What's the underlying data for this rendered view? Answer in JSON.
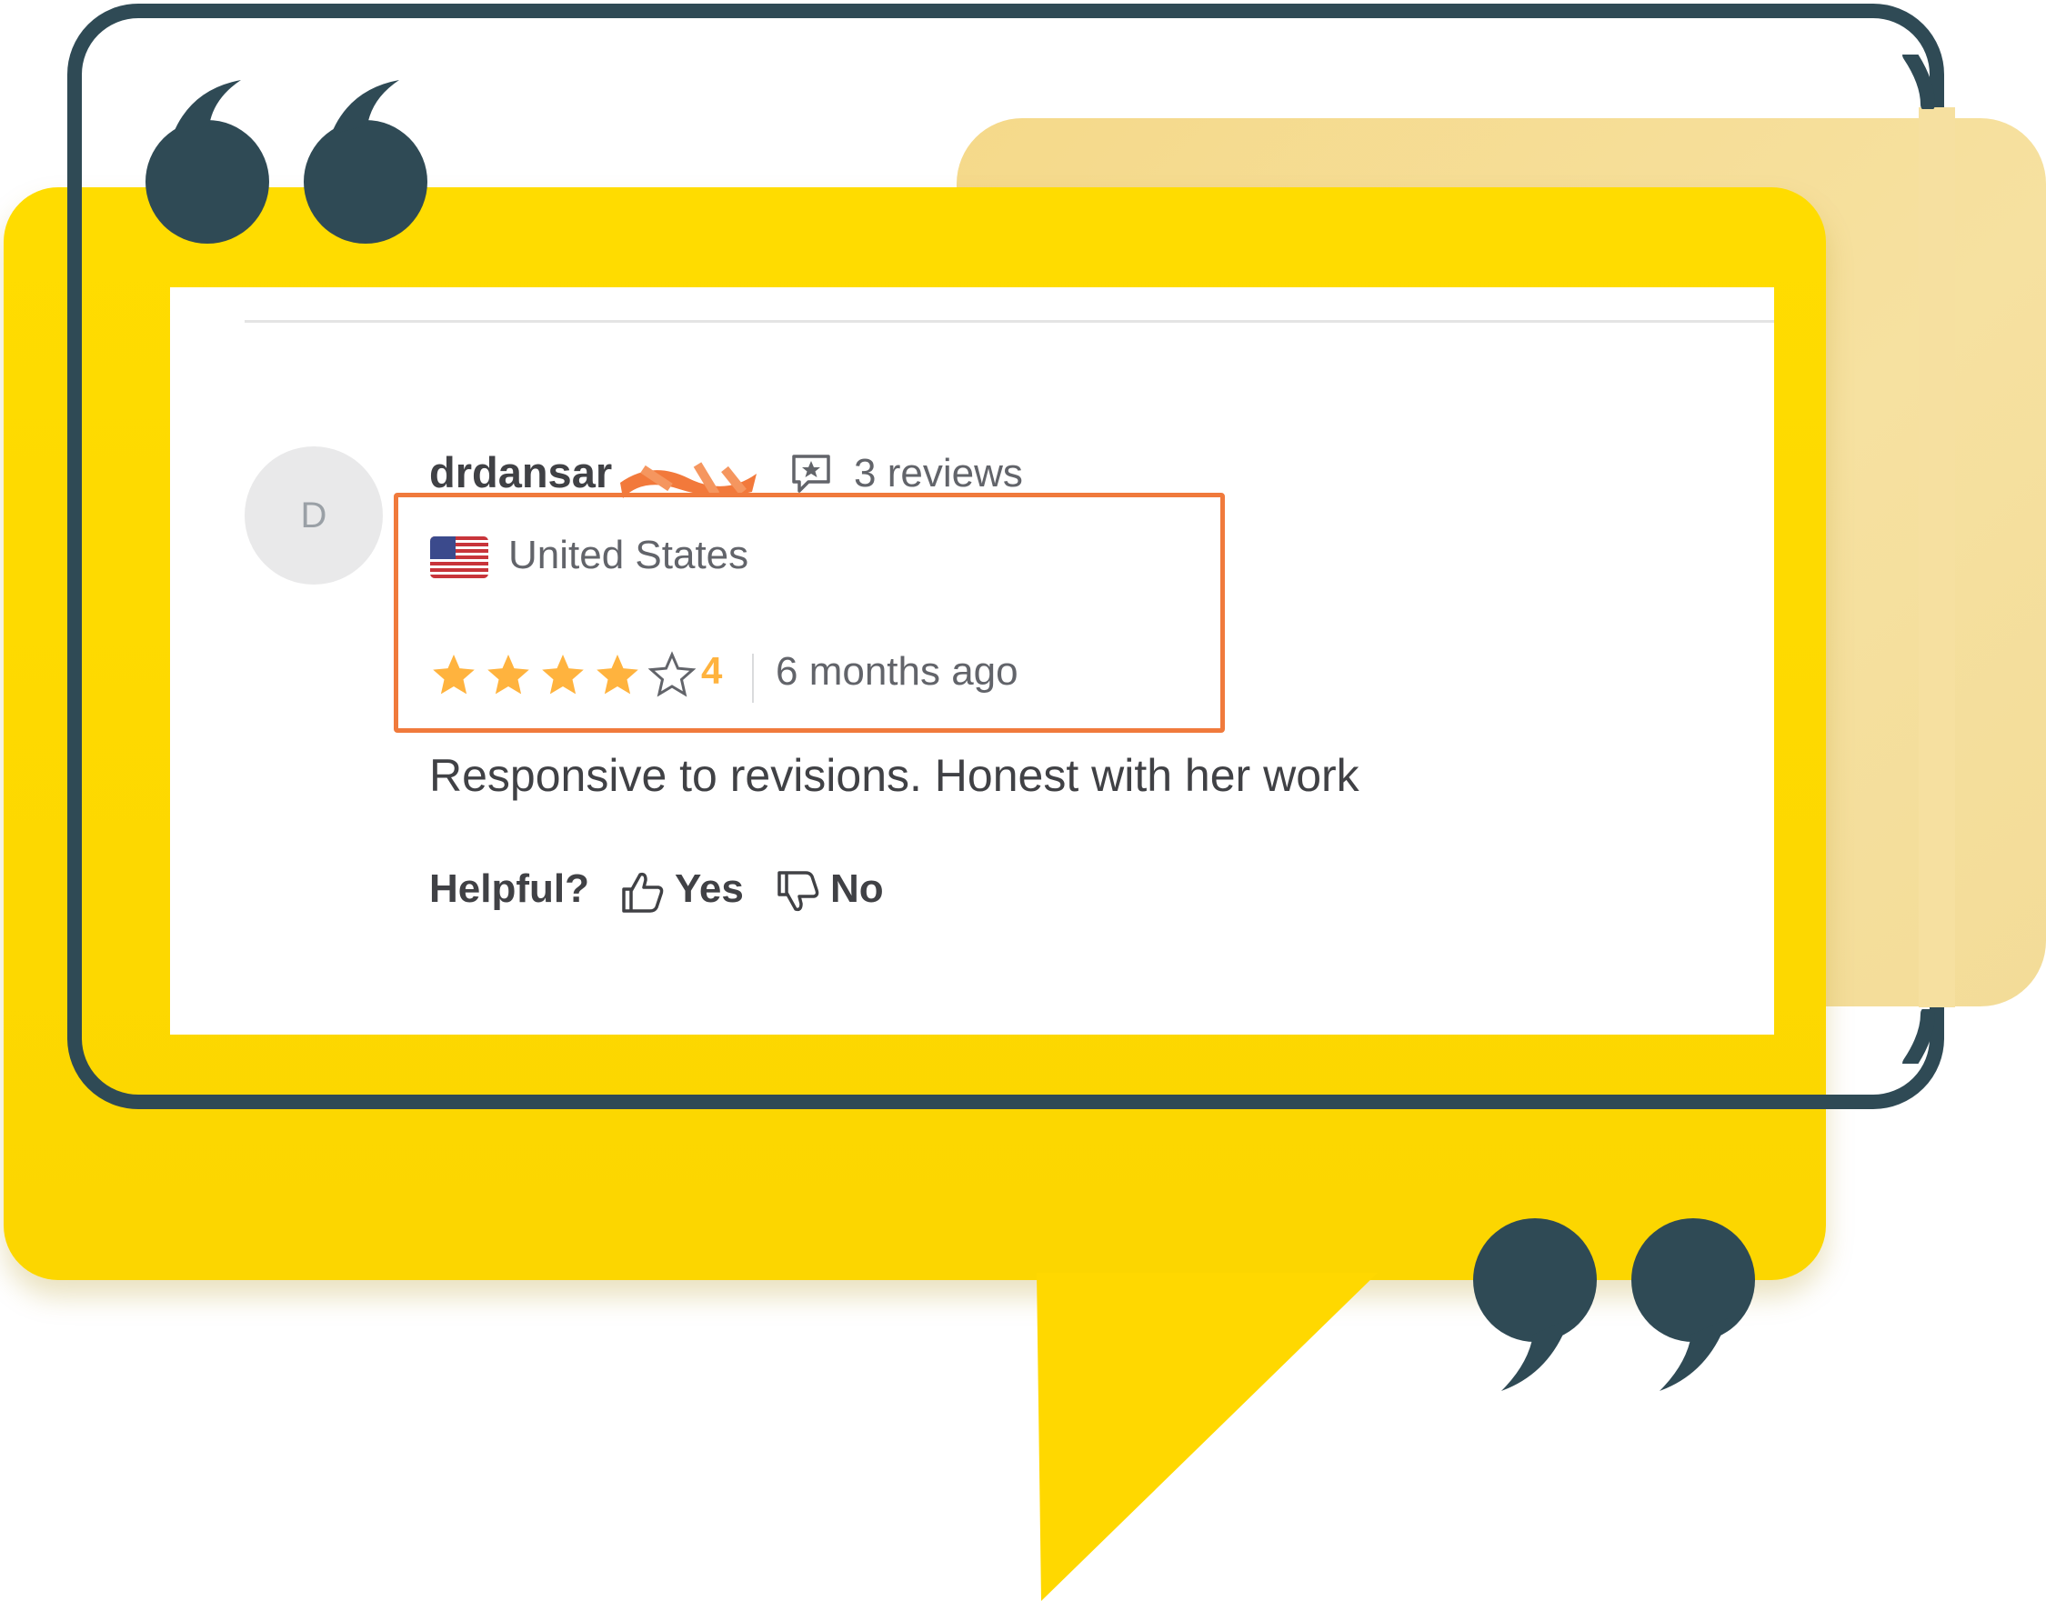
{
  "review": {
    "avatar_initial": "D",
    "username": "drdansar",
    "reviews_count": "3 reviews",
    "country": "United States",
    "rating": "4",
    "stars_filled": 4,
    "stars_total": 5,
    "time_ago": "6 months ago",
    "text": "Responsive to revisions. Honest with her work",
    "helpful_label": "Helpful?",
    "yes_label": "Yes",
    "no_label": "No"
  },
  "colors": {
    "bubble_yellow": "#ffdc00",
    "back_card": "#f5d98a",
    "frame": "#2f4a55",
    "highlight": "#f07a3c",
    "star": "#ffb33e",
    "text_dark": "#404145",
    "text_muted": "#62646a"
  },
  "icons": [
    "open-quote-icon",
    "close-quote-icon",
    "reviews-icon",
    "us-flag-icon",
    "star-icon",
    "thumbs-up-icon",
    "thumbs-down-icon"
  ]
}
